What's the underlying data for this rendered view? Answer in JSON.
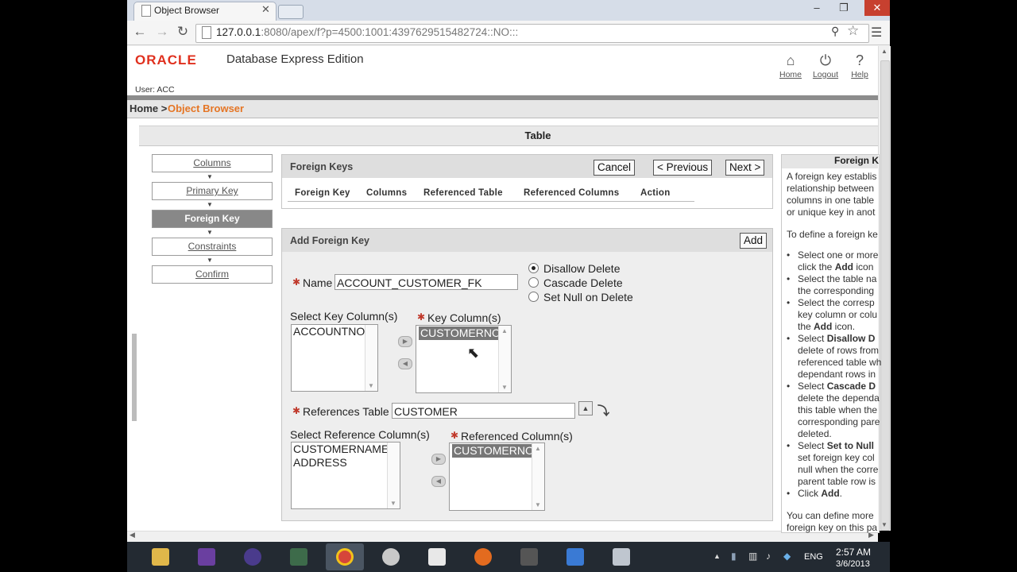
{
  "browser": {
    "tab_title": "Object Browser",
    "url_host": "127.0.0.1",
    "url_rest": ":8080/apex/f?p=4500:1001:4397629515482724::NO:::"
  },
  "app": {
    "logo": "ORACLE",
    "name": "Database Express Edition",
    "user": "User: ACC",
    "header_links": [
      {
        "label": "Home",
        "icon": "home-icon"
      },
      {
        "label": "Logout",
        "icon": "power-icon"
      },
      {
        "label": "Help",
        "icon": "help-icon"
      }
    ]
  },
  "breadcrumb": {
    "home": "Home",
    "sep": " > ",
    "current": "Object Browser"
  },
  "region_title": "Table",
  "wizard_steps": [
    {
      "label": "Columns",
      "active": false
    },
    {
      "label": "Primary Key",
      "active": false
    },
    {
      "label": "Foreign Key",
      "active": true
    },
    {
      "label": "Constraints",
      "active": false
    },
    {
      "label": "Confirm",
      "active": false
    }
  ],
  "foreign_keys": {
    "title": "Foreign Keys",
    "cancel": "Cancel",
    "previous": "< Previous",
    "next": "Next >",
    "columns": [
      "Foreign Key",
      "Columns",
      "Referenced Table",
      "Referenced Columns",
      "Action"
    ]
  },
  "add_fk": {
    "title": "Add Foreign Key",
    "add": "Add",
    "name_label": "Name",
    "name_value": "ACCOUNT_CUSTOMER_FK",
    "delete_options": [
      {
        "label": "Disallow Delete",
        "checked": true
      },
      {
        "label": "Cascade Delete",
        "checked": false
      },
      {
        "label": "Set Null on Delete",
        "checked": false
      }
    ],
    "select_key_label": "Select Key Column(s)",
    "select_key_items": [
      "ACCOUNTNO"
    ],
    "key_label": "Key Column(s)",
    "key_items": [
      "CUSTOMERNO"
    ],
    "ref_table_label": "References Table",
    "ref_table_value": "CUSTOMER",
    "select_ref_label": "Select Reference Column(s)",
    "select_ref_items": [
      "CUSTOMERNAME",
      "ADDRESS"
    ],
    "ref_cols_label": "Referenced Column(s)",
    "ref_cols_items": [
      "CUSTOMERNO"
    ]
  },
  "help": {
    "title": "Foreign K",
    "intro": [
      "A foreign key establis",
      "relationship between",
      "columns in one table",
      "or unique key in anot"
    ],
    "define": "To define a foreign ke",
    "items": [
      [
        "Select one or more",
        "click the ",
        "Add",
        " icon"
      ],
      [
        "Select the table na",
        "the corresponding"
      ],
      [
        "Select the corresp",
        "key column or colu",
        "the ",
        "Add",
        " icon."
      ],
      [
        "Select ",
        "Disallow D",
        "delete of rows from",
        "referenced table wh",
        "dependant rows in"
      ],
      [
        "Select ",
        "Cascade D",
        "delete the dependa",
        "this table when the",
        "corresponding pare",
        "deleted."
      ],
      [
        "Select ",
        "Set to Null",
        "set foreign key col",
        "null when the corre",
        "parent table row is"
      ],
      [
        "Click ",
        "Add",
        "."
      ]
    ],
    "footer": [
      "You can define more",
      "foreign key on this pa"
    ]
  },
  "taskbar": {
    "lang": "ENG",
    "time": "2:57 AM",
    "date": "3/6/2013"
  }
}
